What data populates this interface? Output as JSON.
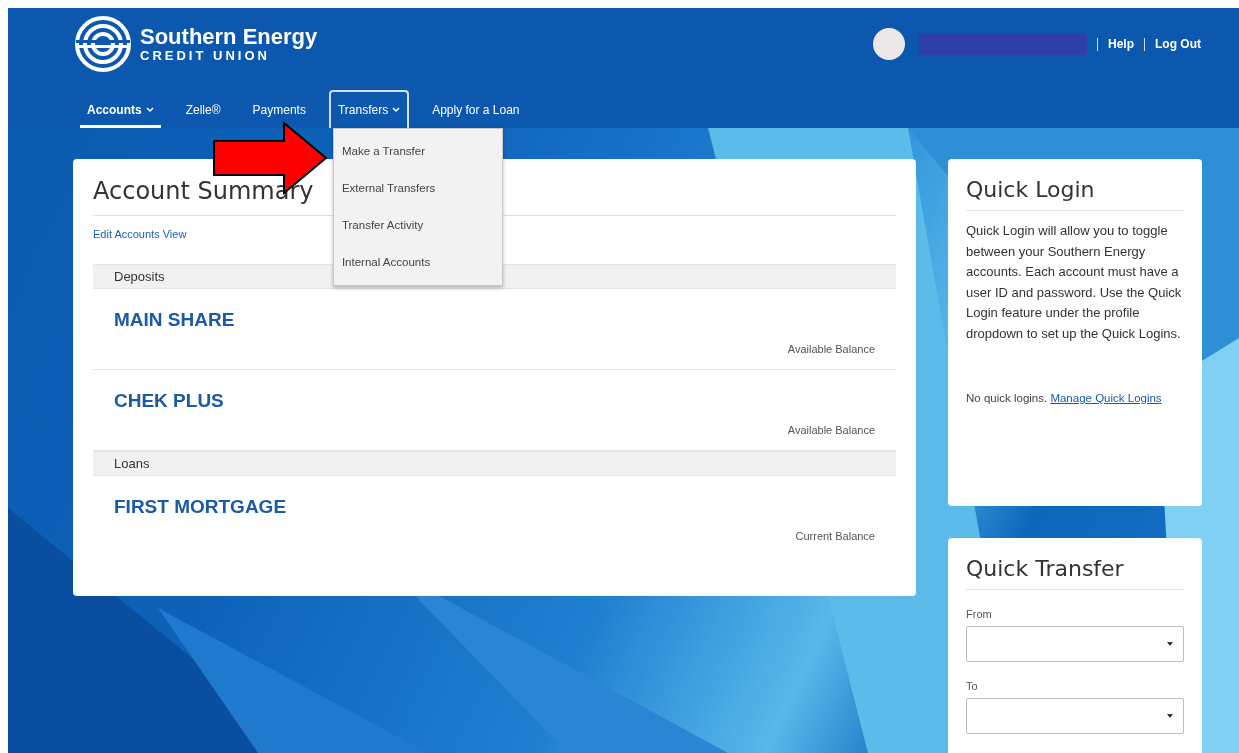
{
  "brand": {
    "name": "Southern Energy",
    "subtitle": "CREDIT UNION"
  },
  "user_links": [
    "Help",
    "Log Out"
  ],
  "nav": [
    {
      "label": "Accounts",
      "selected": true,
      "dropdown": true,
      "expanded": false
    },
    {
      "label": "Zelle®",
      "selected": false,
      "dropdown": false
    },
    {
      "label": "Payments",
      "selected": false,
      "dropdown": false
    },
    {
      "label": "Transfers",
      "selected": false,
      "dropdown": true,
      "expanded": true,
      "menu": [
        "Make a Transfer",
        "External Transfers",
        "Transfer Activity",
        "Internal Accounts"
      ]
    },
    {
      "label": "Apply for a Loan",
      "selected": false,
      "dropdown": false
    }
  ],
  "summary": {
    "title": "Account Summary",
    "edit_link": "Edit Accounts View",
    "groups": [
      {
        "name": "Deposits",
        "accounts": [
          {
            "name": "MAIN SHARE",
            "balance_label": "Available Balance"
          },
          {
            "name": "CHEK PLUS",
            "balance_label": "Available Balance"
          }
        ]
      },
      {
        "name": "Loans",
        "accounts": [
          {
            "name": "FIRST MORTGAGE",
            "balance_label": "Current Balance"
          }
        ]
      }
    ]
  },
  "quick_login": {
    "title": "Quick Login",
    "description": "Quick Login will allow you to toggle between your Southern Energy accounts. Each account must have a user ID and password. Use the Quick Login feature under the profile dropdown to set up the Quick Logins.",
    "status": "No quick logins.",
    "link": "Manage Quick Logins"
  },
  "quick_transfer": {
    "title": "Quick Transfer",
    "fields": [
      {
        "label": "From"
      },
      {
        "label": "To"
      }
    ]
  }
}
